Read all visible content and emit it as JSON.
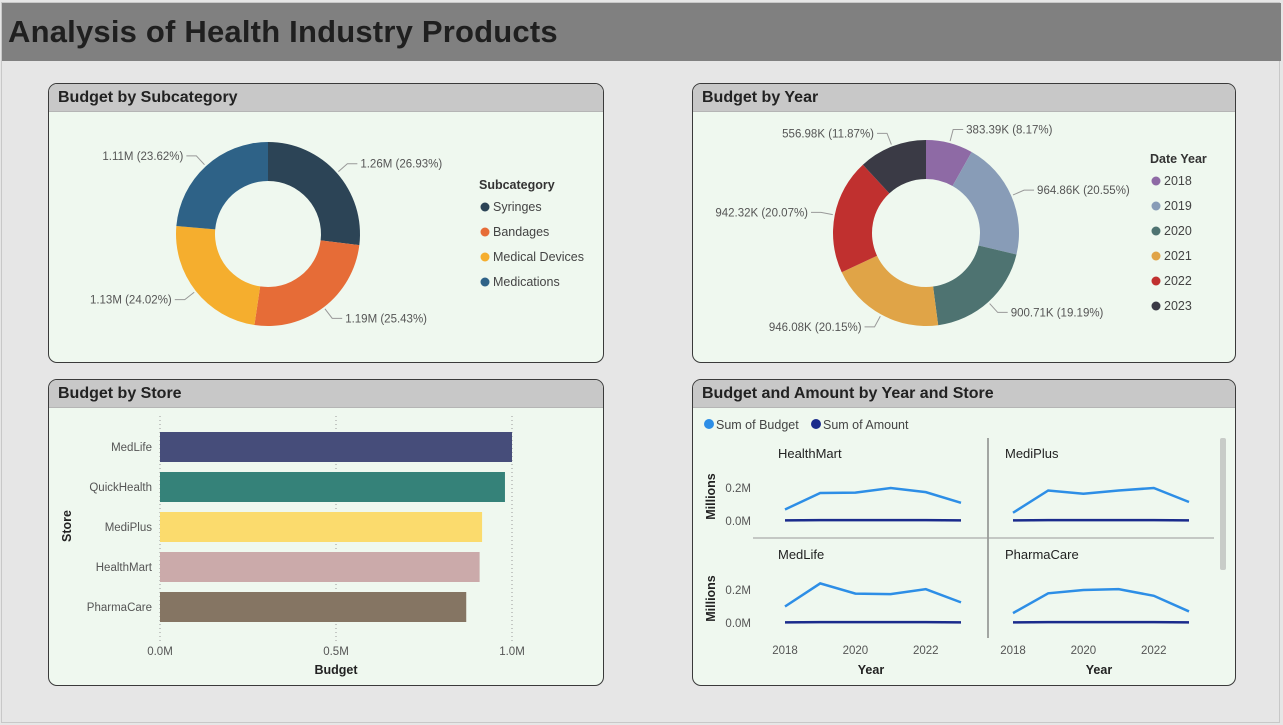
{
  "page": {
    "title": "Analysis of Health Industry Products"
  },
  "panels": {
    "subcategory": {
      "title": "Budget by Subcategory"
    },
    "year": {
      "title": "Budget by Year"
    },
    "store": {
      "title": "Budget by Store"
    },
    "year_store": {
      "title": "Budget and Amount by Year and Store"
    }
  },
  "colors": {
    "syringes": "#2c4456",
    "bandages": "#e66c37",
    "medical_devices": "#f5ae2e",
    "medications": "#2e6287",
    "y2018": "#8e6aa5",
    "y2019": "#889cb7",
    "y2020": "#4e7371",
    "y2021": "#e0a447",
    "y2022": "#c0302f",
    "y2023": "#3a3a45",
    "medlife": "#464d7a",
    "quickhealth": "#358279",
    "mediplus": "#fbdb6d",
    "healthmart": "#cbaaaa",
    "pharmacare": "#857563",
    "budget_line": "#2d8ee6",
    "amount_line": "#1a2b8c"
  },
  "chart_data": [
    {
      "type": "pie",
      "title": "Budget by Subcategory",
      "legend_title": "Subcategory",
      "legend_position": "right",
      "categories": [
        "Syringes",
        "Bandages",
        "Medical Devices",
        "Medications"
      ],
      "values": [
        1.26,
        1.19,
        1.13,
        1.11
      ],
      "labels": [
        "1.26M (26.93%)",
        "1.19M (25.43%)",
        "1.13M (24.02%)",
        "1.11M (23.62%)"
      ],
      "percentages": [
        26.93,
        25.43,
        24.02,
        23.62
      ]
    },
    {
      "type": "pie",
      "title": "Budget by Year",
      "legend_title": "Date Year",
      "legend_position": "right",
      "categories": [
        "2018",
        "2019",
        "2020",
        "2021",
        "2022",
        "2023"
      ],
      "values": [
        383.39,
        964.86,
        900.71,
        946.08,
        942.32,
        556.98
      ],
      "labels": [
        "383.39K (8.17%)",
        "964.86K (20.55%)",
        "900.71K (19.19%)",
        "946.08K (20.15%)",
        "942.32K (20.07%)",
        "556.98K (11.87%)"
      ],
      "percentages": [
        8.17,
        20.55,
        19.19,
        20.15,
        20.07,
        11.87
      ]
    },
    {
      "type": "bar",
      "orientation": "horizontal",
      "title": "Budget by Store",
      "categories": [
        "MedLife",
        "QuickHealth",
        "MediPlus",
        "HealthMart",
        "PharmaCare"
      ],
      "values": [
        1.0,
        0.98,
        0.915,
        0.908,
        0.87
      ],
      "xlabel": "Budget",
      "ylabel": "Store",
      "xlim": [
        0,
        1.0
      ],
      "xticks": [
        "0.0M",
        "0.5M",
        "1.0M"
      ],
      "grid": true
    },
    {
      "type": "line",
      "title": "Budget and Amount by Year and Store",
      "legend": [
        "Sum of Budget",
        "Sum of Amount"
      ],
      "legend_position": "top-left",
      "x": [
        2018,
        2019,
        2020,
        2021,
        2022,
        2023
      ],
      "xticks": [
        "2018",
        "2020",
        "2022"
      ],
      "xlabel": "Year",
      "ylabel": "Millions",
      "yticks": [
        "0.2M",
        "0.0M"
      ],
      "ylim": [
        0,
        0.25
      ],
      "panels": [
        {
          "store": "HealthMart",
          "series": [
            {
              "name": "Sum of Budget",
              "values": [
                0.07,
                0.17,
                0.172,
                0.2,
                0.175,
                0.11
              ]
            },
            {
              "name": "Sum of Amount",
              "values": [
                0.004,
                0.005,
                0.005,
                0.005,
                0.005,
                0.004
              ]
            }
          ]
        },
        {
          "store": "MediPlus",
          "series": [
            {
              "name": "Sum of Budget",
              "values": [
                0.05,
                0.185,
                0.165,
                0.185,
                0.2,
                0.115
              ]
            },
            {
              "name": "Sum of Amount",
              "values": [
                0.004,
                0.005,
                0.005,
                0.005,
                0.005,
                0.004
              ]
            }
          ]
        },
        {
          "store": "MedLife",
          "series": [
            {
              "name": "Sum of Budget",
              "values": [
                0.1,
                0.24,
                0.178,
                0.175,
                0.205,
                0.125
              ]
            },
            {
              "name": "Sum of Amount",
              "values": [
                0.004,
                0.005,
                0.005,
                0.005,
                0.005,
                0.004
              ]
            }
          ]
        },
        {
          "store": "PharmaCare",
          "series": [
            {
              "name": "Sum of Budget",
              "values": [
                0.06,
                0.18,
                0.2,
                0.205,
                0.165,
                0.07
              ]
            },
            {
              "name": "Sum of Amount",
              "values": [
                0.004,
                0.005,
                0.005,
                0.005,
                0.005,
                0.004
              ]
            }
          ]
        }
      ]
    }
  ]
}
